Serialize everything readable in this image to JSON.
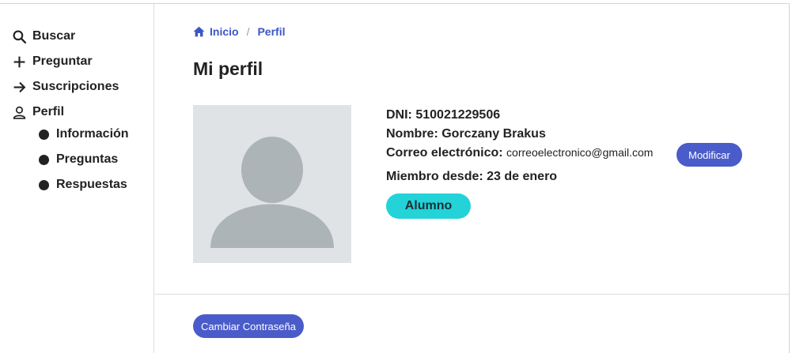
{
  "sidebar": {
    "items": [
      {
        "label": "Buscar",
        "icon": "search-icon"
      },
      {
        "label": "Preguntar",
        "icon": "plus-icon"
      },
      {
        "label": "Suscripciones",
        "icon": "arrow-right-icon"
      },
      {
        "label": "Perfil",
        "icon": "user-icon"
      }
    ],
    "subitems": [
      {
        "label": "Información"
      },
      {
        "label": "Preguntas"
      },
      {
        "label": "Respuestas"
      }
    ]
  },
  "breadcrumb": {
    "home": "Inicio",
    "separator": "/",
    "current": "Perfil"
  },
  "page_title": "Mi perfil",
  "profile": {
    "dni_label": "DNI:",
    "dni_value": "510021229506",
    "name_label": "Nombre:",
    "name_value": "Gorczany Brakus",
    "email_label": "Correo electrónico:",
    "email_value": "correoelectronico@gmail.com",
    "modify_button": "Modificar",
    "member_label": "Miembro desde:",
    "member_value": "23 de enero",
    "role": "Alumno"
  },
  "actions": {
    "change_password": "Cambiar Contraseña"
  },
  "colors": {
    "accent": "#4a5cc9",
    "link": "#3b56c4",
    "role_badge": "#23d3d8",
    "avatar_bg": "#e0e3e5",
    "avatar_fg": "#acb4b7"
  }
}
